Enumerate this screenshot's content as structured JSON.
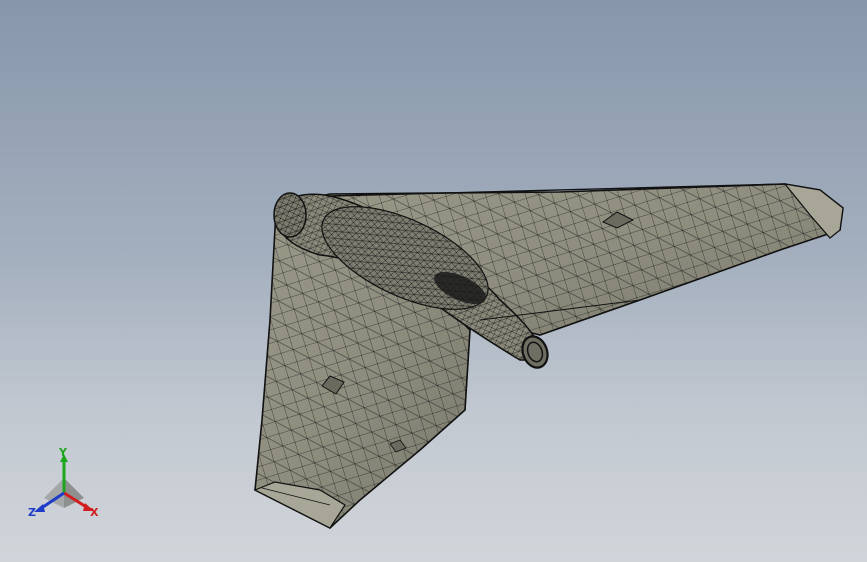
{
  "viewport": {
    "background_top": "#8796ab",
    "background_bottom": "#d1d5da"
  },
  "model": {
    "name": "flying-wing-drone",
    "display_mode": "shaded-with-edges",
    "surface_color": "#8d8c7d",
    "edge_color": "#121212"
  },
  "triad": {
    "x_label": "X",
    "y_label": "Y",
    "z_label": "Z",
    "x_color": "#d21e1e",
    "y_color": "#1ea51e",
    "z_color": "#1e3cc8"
  }
}
